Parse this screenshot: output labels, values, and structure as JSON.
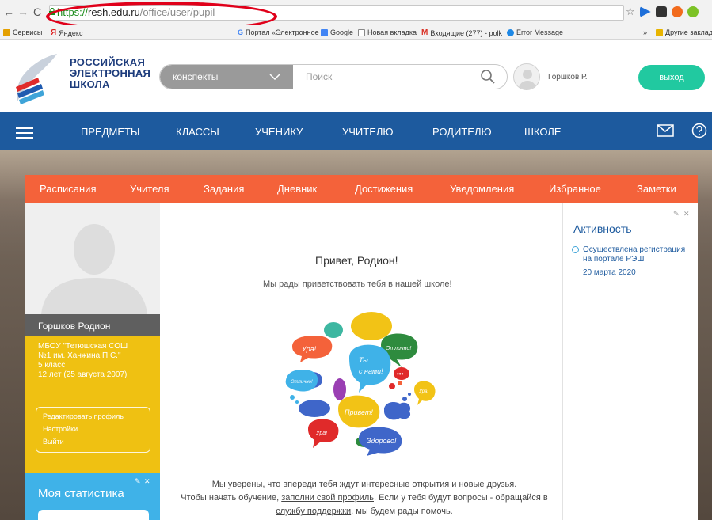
{
  "browser": {
    "url_scheme": "https://",
    "url_host": "resh.edu.ru",
    "url_path": "/office/user/pupil",
    "bookmarks": [
      {
        "label": "Сервисы",
        "icon": "apps-icon",
        "color": "#e4a000"
      },
      {
        "label": "Яндекс",
        "icon": "yandex-icon",
        "color": "#e02020"
      },
      {
        "label": "Портал «Электронное",
        "icon": "google-icon",
        "color": "#4285f4"
      },
      {
        "label": "Google",
        "icon": "google-icon",
        "color": "#4285f4"
      },
      {
        "label": "Новая вкладка",
        "icon": "page-icon",
        "color": "#888888"
      },
      {
        "label": "Входящие (277) - polk",
        "icon": "gmail-icon",
        "color": "#d93025"
      },
      {
        "label": "Error Message",
        "icon": "drop-icon",
        "color": "#1e88e5"
      },
      {
        "label": "»",
        "icon": "",
        "color": "#555555"
      },
      {
        "label": "Другие заклад",
        "icon": "folder-icon",
        "color": "#e8b400"
      }
    ]
  },
  "header": {
    "logo_lines": [
      "РОССИЙСКАЯ",
      "ЭЛЕКТРОННАЯ",
      "ШКОЛА"
    ],
    "search_category": "конспекты",
    "search_placeholder": "Поиск",
    "user_short": "Горшков Р.",
    "logout_label": "выход"
  },
  "nav": {
    "items": [
      "ПРЕДМЕТЫ",
      "КЛАССЫ",
      "УЧЕНИКУ",
      "УЧИТЕЛЮ",
      "РОДИТЕЛЮ",
      "ШКОЛЕ"
    ]
  },
  "tabs": [
    "Расписания",
    "Учителя",
    "Задания",
    "Дневник",
    "Достижения",
    "Уведомления",
    "Избранное",
    "Заметки"
  ],
  "profile": {
    "name": "Горшков Родион",
    "school_lines": [
      "МБОУ \"Тетюшская СОШ",
      "№1 им. Ханжина П.С.\""
    ],
    "grade": "5 класс",
    "age": "12 лет (25 августа 2007)",
    "links": [
      "Редактировать профиль",
      "Настройки",
      "Выйти"
    ],
    "stats_title": "Моя статистика"
  },
  "activity": {
    "title": "Активность",
    "entry_lines": [
      "Осуществлена регистрация",
      "на портале РЭШ"
    ],
    "entry_date": "20 марта 2020"
  },
  "main": {
    "greeting": "Привет, Родион!",
    "welcome": "Мы рады приветствовать тебя в нашей школе!",
    "bubble_words": [
      "Ура!",
      "Отлично!",
      "Ты",
      "с нами!",
      "Отлично!",
      "Ура!",
      "Привет!",
      "Ура!",
      "Здорово!"
    ],
    "bottom_line1": "Мы уверены, что впереди тебя ждут интересные открытия и новые друзья.",
    "bottom_line2_pre": "Чтобы начать обучение, ",
    "bottom_link1": "заполни свой профиль",
    "bottom_line2_post": ". Если у тебя будут вопросы - обращайся в",
    "bottom_link2": "службу поддержки",
    "bottom_line3_post": ", мы будем рады помочь."
  },
  "colors": {
    "nav_blue": "#1d5a9e",
    "tab_orange": "#f4623a",
    "info_yellow": "#efc112",
    "stats_blue": "#3fb2e8",
    "logout_green": "#21c9a0",
    "annotation_red": "#e0001a"
  }
}
